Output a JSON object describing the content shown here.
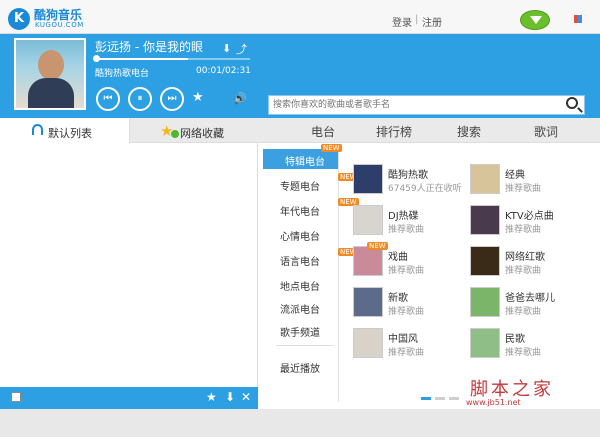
{
  "header": {
    "logo_letter": "K",
    "logo_cn": "酷狗音乐",
    "logo_en": "KUGOU.COM",
    "login": "登录",
    "separator": "|",
    "register": "注册"
  },
  "player": {
    "song_title": "彭远扬 - 你是我的眼",
    "station": "酷狗热歌电台",
    "time": "00:01/02:31",
    "progress": 0.6,
    "prev_icon": "⏮",
    "pause_icon": "⏸",
    "next_icon": "⏭",
    "fav_icon": "★",
    "volume_icon": "🔊",
    "download_icon": "⬇",
    "share_icon": "⤴"
  },
  "search": {
    "placeholder": "搜索你喜欢的歌曲或者歌手名"
  },
  "left_tabs": {
    "default_list": "默认列表",
    "net_favorites": "网络收藏",
    "star_icon": "★"
  },
  "list_bar": {
    "star_icon": "★",
    "download_icon": "⬇",
    "close_icon": "✕"
  },
  "right_tabs": [
    "电台",
    "排行榜",
    "搜索",
    "歌词"
  ],
  "categories": [
    {
      "label": "特辑电台",
      "new": true,
      "active": true
    },
    {
      "label": "专题电台",
      "new": true,
      "active": false
    },
    {
      "label": "年代电台",
      "new": true,
      "active": false
    },
    {
      "label": "心情电台",
      "new": false,
      "active": false
    },
    {
      "label": "语言电台",
      "new": true,
      "active": false
    },
    {
      "label": "地点电台",
      "new": false,
      "active": false
    },
    {
      "label": "流派电台",
      "new": false,
      "active": false
    },
    {
      "label": "歌手频道",
      "new": false,
      "active": false
    },
    {
      "label": "最近播放",
      "new": false,
      "active": false
    }
  ],
  "new_badge": "NEW",
  "stations": [
    {
      "title": "酷狗热歌",
      "sub": "67459人正在收听",
      "color": "#2d3e6b"
    },
    {
      "title": "经典",
      "sub": "推荐歌曲",
      "color": "#d7c49a"
    },
    {
      "title": "DJ热碟",
      "sub": "推荐歌曲",
      "color": "#d8d4d0"
    },
    {
      "title": "KTV必点曲",
      "sub": "推荐歌曲",
      "color": "#4a3a4e"
    },
    {
      "title": "戏曲",
      "sub": "推荐歌曲",
      "color": "#c98a9a"
    },
    {
      "title": "网络红歌",
      "sub": "推荐歌曲",
      "color": "#3a2a18"
    },
    {
      "title": "新歌",
      "sub": "推荐歌曲",
      "color": "#5d6b8a"
    },
    {
      "title": "爸爸去哪儿",
      "sub": "推荐歌曲",
      "color": "#7bb56a"
    },
    {
      "title": "中国风",
      "sub": "推荐歌曲",
      "color": "#d9d2c8"
    },
    {
      "title": "民歌",
      "sub": "推荐歌曲",
      "color": "#8fbf86"
    }
  ],
  "watermark": {
    "cn": "脚本之家",
    "url": "www.jb51.net"
  }
}
